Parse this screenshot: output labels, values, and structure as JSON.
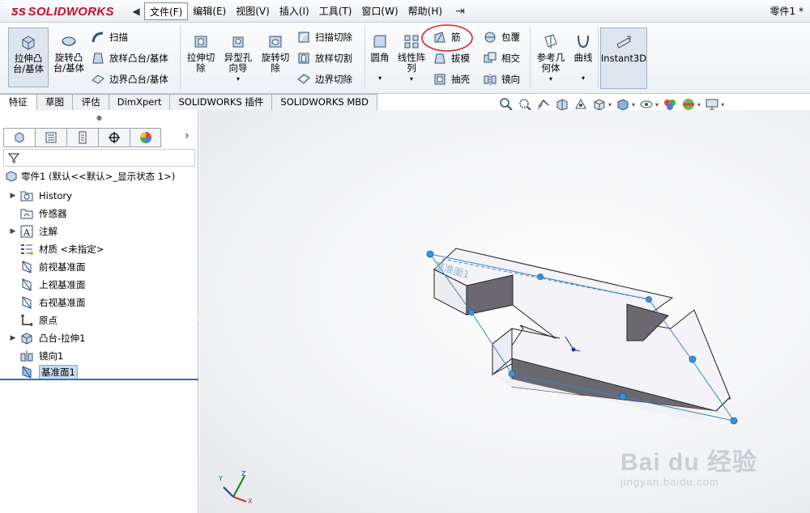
{
  "app": {
    "logo": "SOLIDWORKS",
    "doc_title": "零件1 *"
  },
  "menu": {
    "items": [
      "文件(F)",
      "编辑(E)",
      "视图(V)",
      "插入(I)",
      "工具(T)",
      "窗口(W)",
      "帮助(H)"
    ]
  },
  "ribbon": {
    "extrude_boss": "拉伸凸台/基体",
    "revolve_boss": "旋转凸台/基体",
    "sweep": "扫描",
    "loft_boss": "放样凸台/基体",
    "boundary_boss": "边界凸台/基体",
    "extrude_cut": "拉伸切除",
    "hole_wizard": "异型孔向导",
    "revolve_cut": "旋转切除",
    "sweep_cut": "扫描切除",
    "loft_cut": "放样切割",
    "boundary_cut": "边界切除",
    "fillet": "圆角",
    "linear_pattern": "线性阵列",
    "rib": "筋",
    "draft": "拔模",
    "shell": "抽壳",
    "wrap": "包覆",
    "intersect": "相交",
    "mirror": "镜向",
    "ref_geometry": "参考几何体",
    "curves": "曲线",
    "instant3d": "Instant3D"
  },
  "tabs": [
    "特征",
    "草图",
    "评估",
    "DimXpert",
    "SOLIDWORKS 插件",
    "SOLIDWORKS MBD"
  ],
  "tree": {
    "root": "零件1  (默认<<默认>_显示状态 1>)",
    "items": [
      {
        "label": "History",
        "icon": "history-folder-icon",
        "expandable": true
      },
      {
        "label": "传感器",
        "icon": "sensor-icon",
        "expandable": false
      },
      {
        "label": "注解",
        "icon": "annotation-icon",
        "expandable": true
      },
      {
        "label": "材质 <未指定>",
        "icon": "material-icon",
        "expandable": false
      },
      {
        "label": "前视基准面",
        "icon": "plane-icon",
        "expandable": false
      },
      {
        "label": "上视基准面",
        "icon": "plane-icon",
        "expandable": false
      },
      {
        "label": "右视基准面",
        "icon": "plane-icon",
        "expandable": false
      },
      {
        "label": "原点",
        "icon": "origin-icon",
        "expandable": false
      },
      {
        "label": "凸台-拉伸1",
        "icon": "extrude-feature-icon",
        "expandable": true
      },
      {
        "label": "镜向1",
        "icon": "mirror-feature-icon",
        "expandable": false
      },
      {
        "label": "基准面1",
        "icon": "plane-icon",
        "expandable": false,
        "selected": true
      }
    ]
  },
  "viewport": {
    "plane_label": "基准面1",
    "triad_axes": [
      "X",
      "Y",
      "Z"
    ],
    "colors": {
      "plane_edge": "#3b82c4",
      "highlight_circle": "#d9232d",
      "selection": "#c8dcf3"
    }
  },
  "watermark": {
    "brand": "Bai du 经验",
    "url": "jingyan.baidu.com"
  }
}
